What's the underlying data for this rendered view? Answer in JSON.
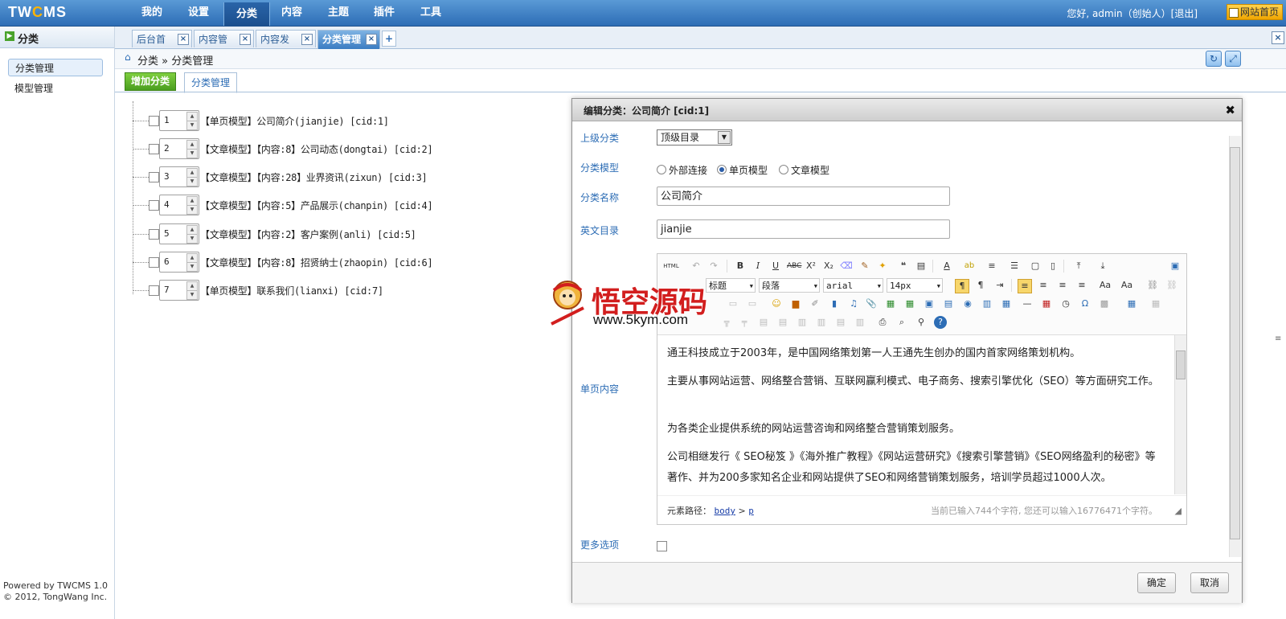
{
  "app": {
    "logo_text": "TWCMS",
    "greeting": "您好, admin（创始人）[退出]",
    "home_button": "网站首页",
    "nav": [
      "我的",
      "设置",
      "分类",
      "内容",
      "主题",
      "插件",
      "工具"
    ],
    "active_nav": "分类"
  },
  "sidebar": {
    "title": "分类",
    "items": [
      "分类管理",
      "模型管理"
    ],
    "footer_line1": "Powered by TWCMS 1.0",
    "footer_line2": "© 2012, TongWang Inc."
  },
  "tabs": [
    "后台首页",
    "内容管理",
    "内容发布",
    "分类管理"
  ],
  "tab_close_glyph": "×",
  "tab_add_glyph": "+",
  "breadcrumb": "分类 » 分类管理",
  "toolbar": {
    "add_button": "增加分类",
    "subtab": "分类管理"
  },
  "tree": [
    {
      "order": "1",
      "label": "【单页模型】公司简介(jianjie) [cid:1]"
    },
    {
      "order": "2",
      "label": "【文章模型】【内容:8】公司动态(dongtai) [cid:2]"
    },
    {
      "order": "3",
      "label": "【文章模型】【内容:28】业界资讯(zixun) [cid:3]"
    },
    {
      "order": "4",
      "label": "【文章模型】【内容:5】产品展示(chanpin) [cid:4]"
    },
    {
      "order": "5",
      "label": "【文章模型】【内容:2】客户案例(anli) [cid:5]"
    },
    {
      "order": "6",
      "label": "【文章模型】【内容:8】招贤纳士(zhaopin) [cid:6]"
    },
    {
      "order": "7",
      "label": "【单页模型】联系我们(lianxi) [cid:7]"
    }
  ],
  "dialog": {
    "title": "编辑分类：公司简介 [cid:1]",
    "labels": {
      "parent": "上级分类",
      "model": "分类模型",
      "name": "分类名称",
      "dir": "英文目录",
      "content": "单页内容",
      "more": "更多选项"
    },
    "parent_value": "顶级目录",
    "model_options": [
      "外部连接",
      "单页模型",
      "文章模型"
    ],
    "model_selected": "单页模型",
    "name_value": "公司简介",
    "dir_value": "jianjie",
    "editor": {
      "font_heading": "标题",
      "paragraph": "段落",
      "font_family": "arial",
      "font_size": "14px",
      "html_btn": "HTML",
      "paragraphs": [
        "通王科技成立于2003年，是中国网络策划第一人王通先生创办的国内首家网络策划机构。",
        "主要从事网站运营、网络整合营销、互联网赢利模式、电子商务、搜索引擎优化（SEO）等方面研究工作。",
        "为各类企业提供系统的网站运营咨询和网络整合营销策划服务。",
        "公司相继发行《 SEO秘笈 》《海外推广教程》《网站运营研究》《搜索引擎营销》《SEO网络盈利的秘密》等著作、并为200多家知名企业和网站提供了SEO和网络营销策划服务，培训学员超过1000人次。"
      ],
      "path_label": "元素路径：",
      "path_items": [
        "body",
        "p"
      ],
      "path_sep": ">",
      "char_count": "当前已输入744个字符, 您还可以输入16776471个字符。"
    },
    "ok_button": "确定",
    "cancel_button": "取消"
  },
  "watermark": {
    "text": "悟空源码",
    "url": "www.5kym.com"
  },
  "colors": {
    "topbar": "#2d6db5",
    "label_blue": "#2d6db5",
    "add_green": "#4a9e1e",
    "watermark_red": "#d21e1e"
  }
}
